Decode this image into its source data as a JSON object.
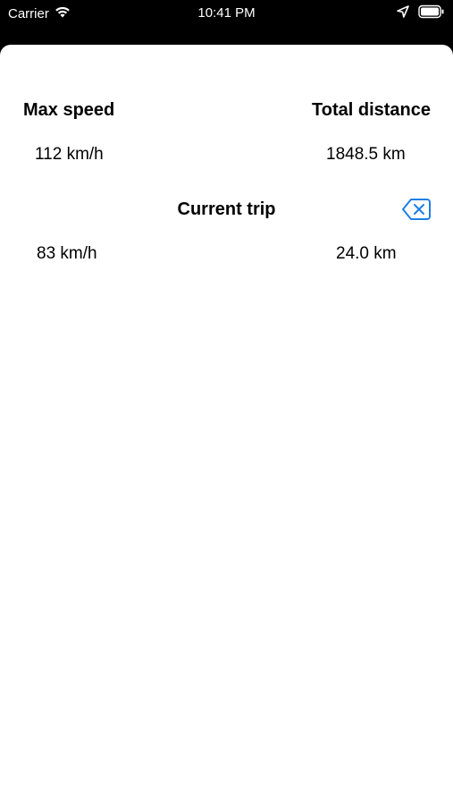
{
  "status_bar": {
    "carrier": "Carrier",
    "time": "10:41 PM",
    "icons": [
      "wifi-icon",
      "location-arrow-icon",
      "battery-icon"
    ]
  },
  "stats": {
    "max_speed_label": "Max speed",
    "total_distance_label": "Total distance",
    "max_speed_value": "112 km/h",
    "total_distance_value": "1848.5 km",
    "current_trip_label": "Current trip",
    "current_trip_speed": "83 km/h",
    "current_trip_distance": "24.0 km",
    "clear_icon": "delete-left-icon"
  },
  "colors": {
    "accent": "#1E7FE6",
    "background": "#FFFFFF",
    "status_bar_background": "#000000"
  }
}
